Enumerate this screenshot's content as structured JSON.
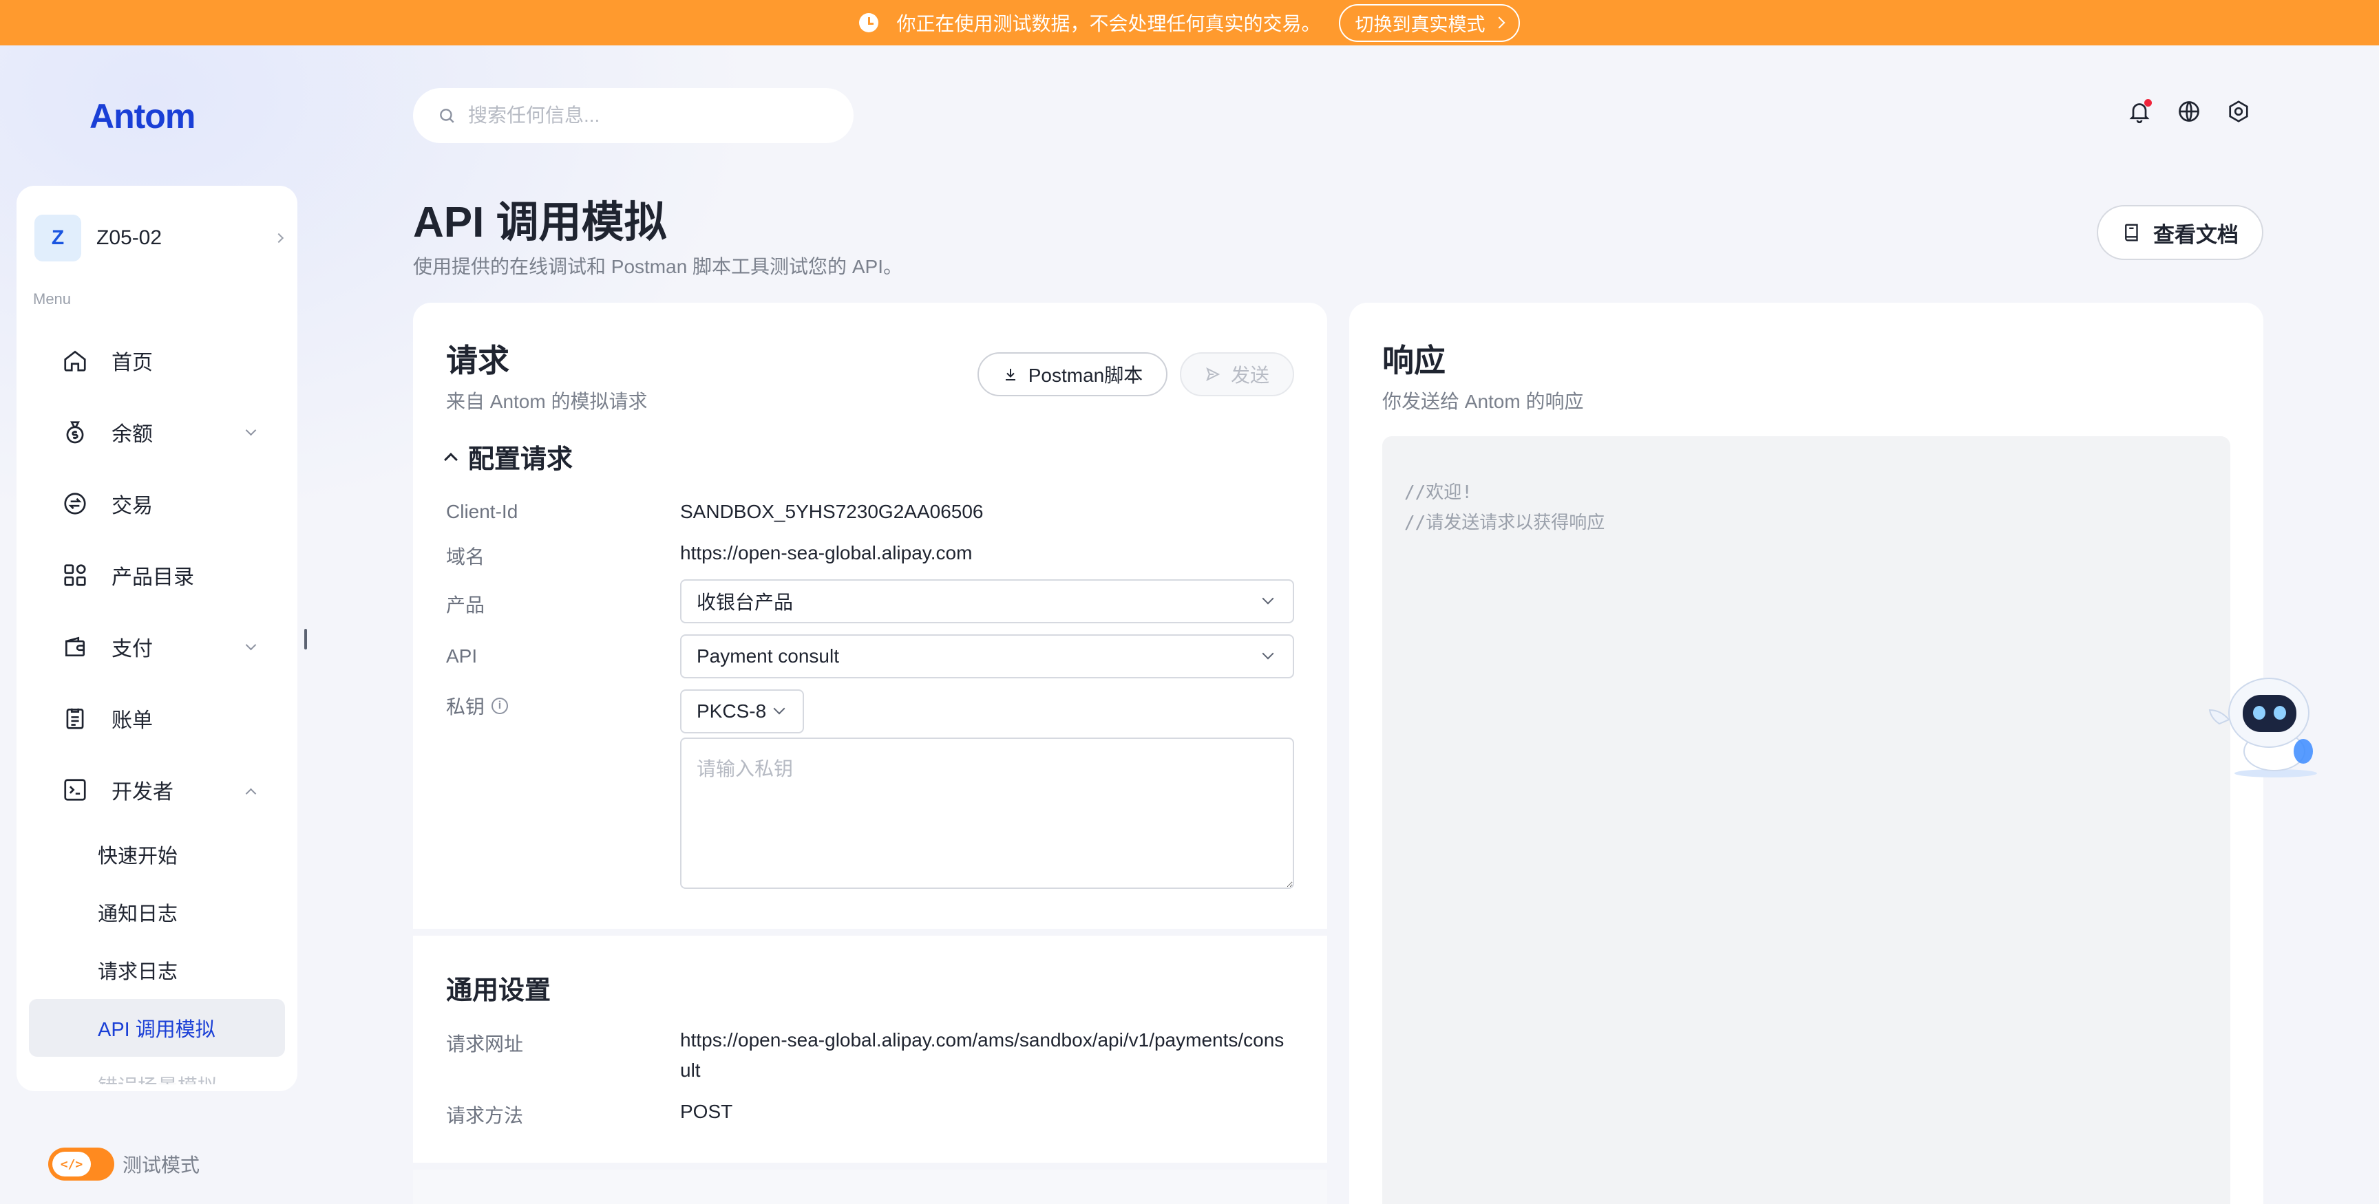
{
  "banner": {
    "message": "你正在使用测试数据，不会处理任何真实的交易。",
    "switch_label": "切换到真实模式"
  },
  "brand": {
    "logo_text": "Antom",
    "color": "#1a3fd6"
  },
  "account": {
    "avatar_letter": "Z",
    "name": "Z05-02"
  },
  "sidebar": {
    "menu_label": "Menu",
    "items": [
      {
        "label": "首页",
        "icon": "home-icon"
      },
      {
        "label": "余额",
        "icon": "money-bag-icon",
        "expandable": true
      },
      {
        "label": "交易",
        "icon": "exchange-icon"
      },
      {
        "label": "产品目录",
        "icon": "grid-icon"
      },
      {
        "label": "支付",
        "icon": "wallet-icon",
        "expandable": true
      },
      {
        "label": "账单",
        "icon": "bill-icon"
      },
      {
        "label": "开发者",
        "icon": "terminal-icon",
        "expanded": true
      }
    ],
    "developer_sub": [
      "快速开始",
      "通知日志",
      "请求日志",
      "API 调用模拟",
      "错误场景模拟"
    ],
    "active_sub": "API 调用模拟"
  },
  "test_mode": {
    "label": "测试模式",
    "enabled": true,
    "toggle_glyph": "</>"
  },
  "search": {
    "placeholder": "搜索任何信息..."
  },
  "page": {
    "title": "API 调用模拟",
    "subtitle": "使用提供的在线调试和 Postman 脚本工具测试您的 API。",
    "docs_button": "查看文档"
  },
  "request": {
    "title": "请求",
    "subtitle": "来自 Antom 的模拟请求",
    "postman_button": "Postman脚本",
    "send_button": "发送",
    "config_title": "配置请求",
    "fields": {
      "client_id_label": "Client-Id",
      "client_id_value": "SANDBOX_5YHS7230G2AA06506",
      "domain_label": "域名",
      "domain_value": "https://open-sea-global.alipay.com",
      "product_label": "产品",
      "product_value": "收银台产品",
      "api_label": "API",
      "api_value": "Payment consult",
      "key_label": "私钥",
      "key_format": "PKCS-8",
      "key_placeholder": "请输入私钥"
    }
  },
  "common_settings": {
    "title": "通用设置",
    "url_label": "请求网址",
    "url_value_line1": "https://open-sea-global.alipay.com/ams/sandbox/api/v1/payments/cons",
    "url_value_line2": "ult",
    "method_label": "请求方法",
    "method_value": "POST"
  },
  "response": {
    "title": "响应",
    "subtitle": "你发送给 Antom 的响应",
    "code_line1": "//欢迎!",
    "code_line2": "//请发送请求以获得响应"
  },
  "colors": {
    "banner": "#ff9a2e",
    "accent": "#1a3fd6",
    "toggle": "#ff8a1f",
    "notification_dot": "#f0243b"
  }
}
